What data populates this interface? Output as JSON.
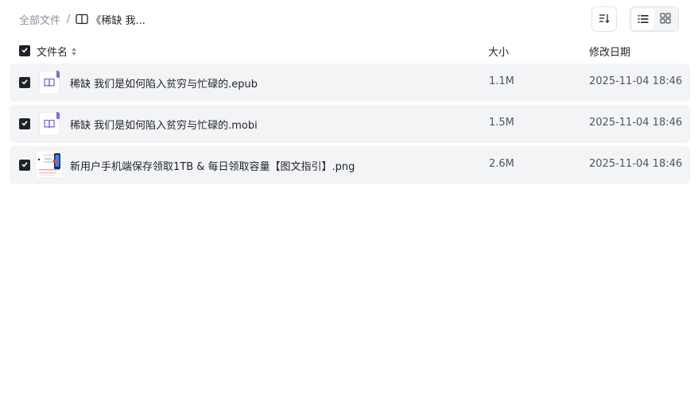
{
  "breadcrumb": {
    "root": "全部文件",
    "separator": "/",
    "current_icon": "book-icon",
    "current": "《稀缺 我..."
  },
  "toolbar": {
    "sort_icon": "sort-icon",
    "list_view_icon": "list-view-icon",
    "grid_view_icon": "grid-view-icon",
    "active_view": "list"
  },
  "table": {
    "columns": {
      "name": "文件名",
      "size": "大小",
      "date": "修改日期"
    },
    "all_selected": true,
    "rows": [
      {
        "name": "稀缺 我们是如何陷入贫穷与忙碌的.epub",
        "size": "1.1M",
        "date": "2025-11-04 18:46",
        "icon": "ebook-file-icon",
        "selected": true
      },
      {
        "name": "稀缺 我们是如何陷入贫穷与忙碌的.mobi",
        "size": "1.5M",
        "date": "2025-11-04 18:46",
        "icon": "ebook-file-icon",
        "selected": true
      },
      {
        "name": "新用户手机端保存领取1TB & 每日领取容量【图文指引】.png",
        "size": "2.6M",
        "date": "2025-11-04 18:46",
        "icon": "image-thumbnail",
        "selected": true
      }
    ]
  },
  "colors": {
    "accent": "#7b6ce0",
    "row_bg": "#f3f4f5",
    "checkbox": "#1f2329",
    "muted_text": "#8a8f99"
  }
}
